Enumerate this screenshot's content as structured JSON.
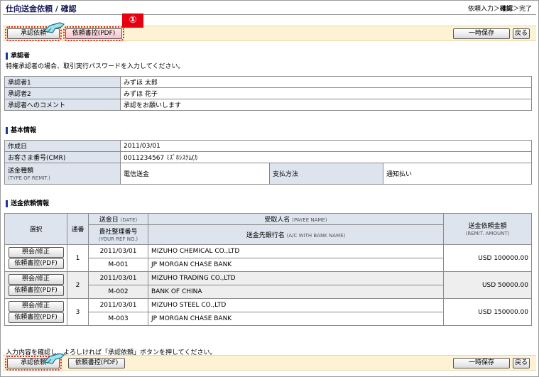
{
  "header": {
    "title": "仕向送金依頼 / 確認",
    "breadcrumb_pre": "依頼入力＞",
    "breadcrumb_current": "確認",
    "breadcrumb_post": "＞完了"
  },
  "toolbar": {
    "approve": "承認依頼",
    "pdf": "依頼書控(PDF)",
    "save": "一時保存",
    "back": "戻る",
    "badge": "①"
  },
  "approver": {
    "heading": "承認者",
    "note": "特権承認者の場合、取引実行パスワードを入力してください。",
    "rows": [
      {
        "label": "承認者1",
        "value": "みずほ 太郎"
      },
      {
        "label": "承認者2",
        "value": "みずほ 花子"
      },
      {
        "label": "承認者へのコメント",
        "value": "承認をお願いします"
      }
    ]
  },
  "basic": {
    "heading": "基本情報",
    "created_label": "作成日",
    "created_value": "2011/03/01",
    "cmr_label": "お客さま番号(CMR)",
    "cmr_value": "0011234567 ﾐｽﾞﾎｼｽﾃﾑ(ｶ",
    "remit_type_label": "送金種類",
    "remit_type_sub": "(TYPE OF REMIT.)",
    "remit_type_value": "電信送金",
    "payment_label": "支払方法",
    "payment_value": "通知払い"
  },
  "remit": {
    "heading": "送金依頼情報",
    "col_select": "選択",
    "col_no": "通番",
    "col_date": "送金日",
    "col_date_sub": "(DATE)",
    "col_ref": "貴社整理番号",
    "col_ref_sub": "(YOUR REF NO.)",
    "col_payee": "受取人名",
    "col_payee_sub": "(PAYEE NAME)",
    "col_bank": "送金先銀行名",
    "col_bank_sub": "(A/C WITH BANK NAME)",
    "col_amount": "送金依頼金額",
    "col_amount_sub": "(REMIT. AMOUNT)",
    "btn_edit": "照会/修正",
    "btn_pdf": "依頼書控(PDF)",
    "rows": [
      {
        "no": "1",
        "date": "2011/03/01",
        "ref": "M-001",
        "payee": "MIZUHO CHEMICAL CO.,LTD",
        "bank": "JP MORGAN CHASE BANK",
        "amount": "USD 100000.00"
      },
      {
        "no": "2",
        "date": "2011/03/01",
        "ref": "M-002",
        "payee": "MIZUHO TRADING CO.,LTD",
        "bank": "BANK OF CHINA",
        "amount": "USD 50000.00"
      },
      {
        "no": "3",
        "date": "2011/03/01",
        "ref": "M-003",
        "payee": "MIZUHO STEEL CO.,LTD",
        "bank": "JP MORGAN CHASE BANK",
        "amount": "USD 150000.00"
      }
    ]
  },
  "footer_note": "入力内容を確認し、よろしければ「承認依頼」ボタンを押してください。",
  "colors": {
    "accent_red": "#e60012",
    "header_bg": "#dde4ee",
    "button_bar": "#fdf3d4"
  }
}
